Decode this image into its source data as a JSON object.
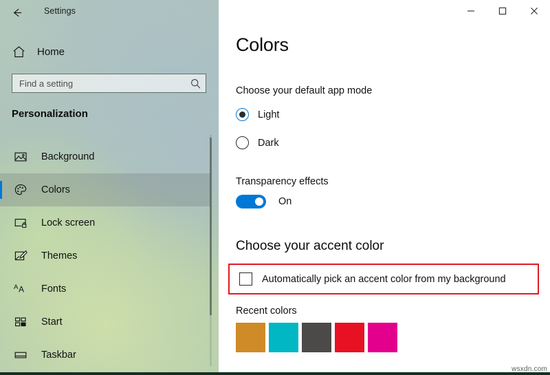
{
  "window": {
    "app_title": "Settings",
    "back_icon": "back-arrow-icon",
    "controls": {
      "minimize": "—",
      "maximize": "□",
      "close": "✕"
    }
  },
  "sidebar": {
    "home_label": "Home",
    "home_icon": "home-icon",
    "search": {
      "placeholder": "Find a setting",
      "value": "",
      "icon": "search-icon"
    },
    "section_title": "Personalization",
    "items": [
      {
        "label": "Background",
        "icon": "picture-icon",
        "selected": false
      },
      {
        "label": "Colors",
        "icon": "palette-icon",
        "selected": true
      },
      {
        "label": "Lock screen",
        "icon": "lock-screen-icon",
        "selected": false
      },
      {
        "label": "Themes",
        "icon": "paintbrush-icon",
        "selected": false
      },
      {
        "label": "Fonts",
        "icon": "fonts-aa-icon",
        "selected": false
      },
      {
        "label": "Start",
        "icon": "start-tiles-icon",
        "selected": false
      },
      {
        "label": "Taskbar",
        "icon": "taskbar-icon",
        "selected": false
      }
    ]
  },
  "main": {
    "page_title": "Colors",
    "app_mode": {
      "label": "Choose your default app mode",
      "options": [
        {
          "label": "Light",
          "selected": true
        },
        {
          "label": "Dark",
          "selected": false
        }
      ]
    },
    "transparency": {
      "label": "Transparency effects",
      "state_label": "On",
      "enabled": true
    },
    "accent": {
      "heading": "Choose your accent color",
      "auto_pick_label": "Automatically pick an accent color from my background",
      "auto_pick_checked": false,
      "highlight_color": "#e01b24"
    },
    "recent_colors": {
      "label": "Recent colors",
      "swatches": [
        {
          "name": "orange",
          "hex": "#ce8b28"
        },
        {
          "name": "cyan",
          "hex": "#00b7c3"
        },
        {
          "name": "dark-gray",
          "hex": "#4c4a48"
        },
        {
          "name": "red",
          "hex": "#e81123"
        },
        {
          "name": "magenta",
          "hex": "#e3008c"
        }
      ]
    }
  },
  "watermark": "wsxdn.com",
  "accent_color": "#0078d7"
}
